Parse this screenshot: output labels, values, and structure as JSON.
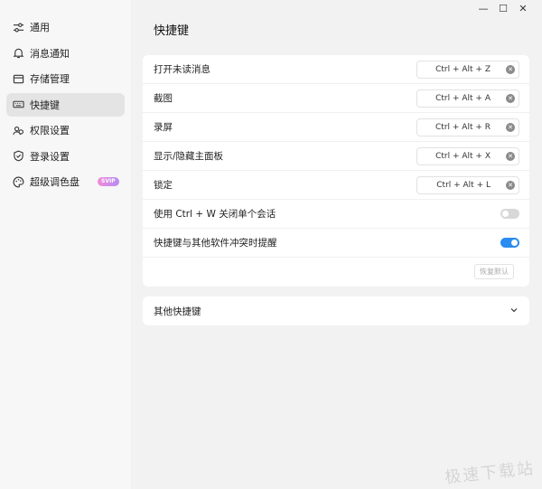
{
  "sidebar": {
    "items": [
      {
        "label": "通用",
        "icon": "sliders-icon"
      },
      {
        "label": "消息通知",
        "icon": "bell-icon"
      },
      {
        "label": "存储管理",
        "icon": "folder-icon"
      },
      {
        "label": "快捷键",
        "icon": "keyboard-icon",
        "active": true
      },
      {
        "label": "权限设置",
        "icon": "people-icon"
      },
      {
        "label": "登录设置",
        "icon": "shield-icon"
      },
      {
        "label": "超级调色盘",
        "icon": "palette-icon",
        "badge": "SVIP"
      }
    ]
  },
  "window": {
    "minimize": "—",
    "maximize": "☐",
    "close": "✕"
  },
  "page": {
    "title": "快捷键"
  },
  "shortcuts": [
    {
      "label": "打开未读消息",
      "keys": "Ctrl + Alt + Z"
    },
    {
      "label": "截图",
      "keys": "Ctrl + Alt + A"
    },
    {
      "label": "录屏",
      "keys": "Ctrl + Alt + R"
    },
    {
      "label": "显示/隐藏主面板",
      "keys": "Ctrl + Alt + X"
    },
    {
      "label": "锁定",
      "keys": "Ctrl + Alt + L"
    }
  ],
  "toggles": [
    {
      "label": "使用 Ctrl + W 关闭单个会话",
      "on": false
    },
    {
      "label": "快捷键与其他软件冲突时提醒",
      "on": true
    }
  ],
  "restore_default": "恢复默认",
  "other": {
    "label": "其他快捷键"
  },
  "watermark": "极速下载站",
  "colors": {
    "accent": "#2a8cf0",
    "sidebar_active": "#e4e4e4"
  }
}
